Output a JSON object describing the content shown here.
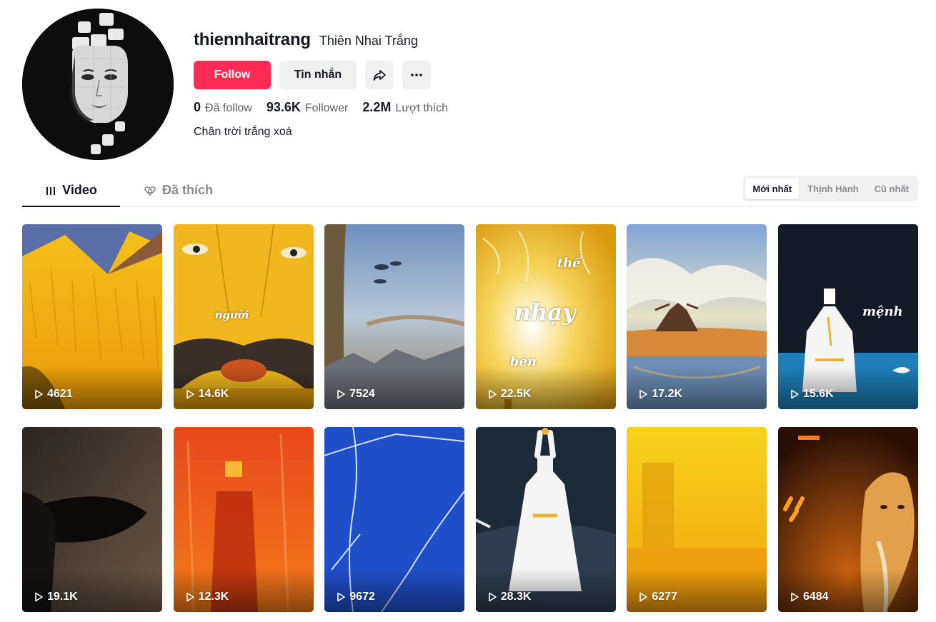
{
  "profile": {
    "username": "thiennhaitrang",
    "nickname": "Thiên Nhai Trắng",
    "follow_label": "Follow",
    "message_label": "Tin nhắn",
    "share_icon": "share-icon",
    "more_icon": "more-icon",
    "stats": {
      "following_count": "0",
      "following_label": "Đã follow",
      "followers_count": "93.6K",
      "followers_label": "Follower",
      "likes_count": "2.2M",
      "likes_label": "Lượt thích"
    },
    "bio": "Chân trời trắng xoá"
  },
  "tabs": {
    "video_label": "Video",
    "liked_label": "Đã thích",
    "active": "Video"
  },
  "sort": {
    "options": [
      "Mới nhất",
      "Thịnh Hành",
      "Cũ nhất"
    ],
    "active": "Mới nhất"
  },
  "videos": [
    {
      "views": "4621"
    },
    {
      "views": "14.6K",
      "overlay": "người"
    },
    {
      "views": "7524"
    },
    {
      "views": "22.5K",
      "overlay_lines": [
        "thể",
        "nhạy",
        "bén"
      ]
    },
    {
      "views": "17.2K"
    },
    {
      "views": "15.6K",
      "overlay": "mệnh"
    },
    {
      "views": "19.1K"
    },
    {
      "views": "12.3K"
    },
    {
      "views": "9672"
    },
    {
      "views": "28.3K"
    },
    {
      "views": "6277"
    },
    {
      "views": "6484"
    }
  ],
  "colors": {
    "brand": "#fe2c55",
    "text": "#161823",
    "muted": "#8a8b91",
    "button_bg": "#f1f1f2"
  }
}
